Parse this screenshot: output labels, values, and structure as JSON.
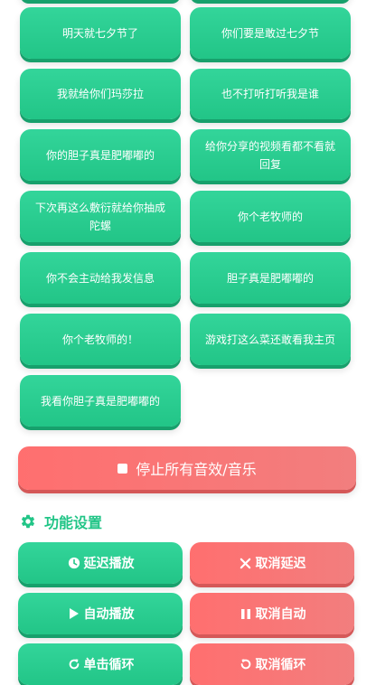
{
  "sounds": [
    {
      "label": "明天就七夕节了"
    },
    {
      "label": "你们要是敢过七夕节"
    },
    {
      "label": "我就给你们玛莎拉"
    },
    {
      "label": "也不打听打听我是谁"
    },
    {
      "label": "你的胆子真是肥嘟嘟的"
    },
    {
      "label": "给你分享的视频看都不看就回复"
    },
    {
      "label": "下次再这么敷衍就给你抽成陀螺"
    },
    {
      "label": "你个老牧师的"
    },
    {
      "label": "你不会主动给我发信息"
    },
    {
      "label": "胆子真是肥嘟嘟的"
    },
    {
      "label": "你个老牧师的！"
    },
    {
      "label": "游戏打这么菜还敢看我主页"
    },
    {
      "label": "我看你胆子真是肥嘟嘟的"
    }
  ],
  "stop_all": {
    "label": "停止所有音效/音乐",
    "icon": "stop-square-icon"
  },
  "settings": {
    "title": "功能设置",
    "icon": "gear-icon",
    "delay_play": {
      "label": "延迟播放",
      "icon": "clock-icon"
    },
    "cancel_delay": {
      "label": "取消延迟",
      "icon": "x-icon"
    },
    "auto_play": {
      "label": "自动播放",
      "icon": "play-icon"
    },
    "cancel_auto": {
      "label": "取消自动",
      "icon": "pause-icon"
    },
    "single_loop": {
      "label": "单击循环",
      "icon": "redo-icon"
    },
    "cancel_loop": {
      "label": "取消循环",
      "icon": "undo-icon"
    }
  },
  "colors": {
    "green": "#22c587",
    "red": "#f27e7e"
  }
}
